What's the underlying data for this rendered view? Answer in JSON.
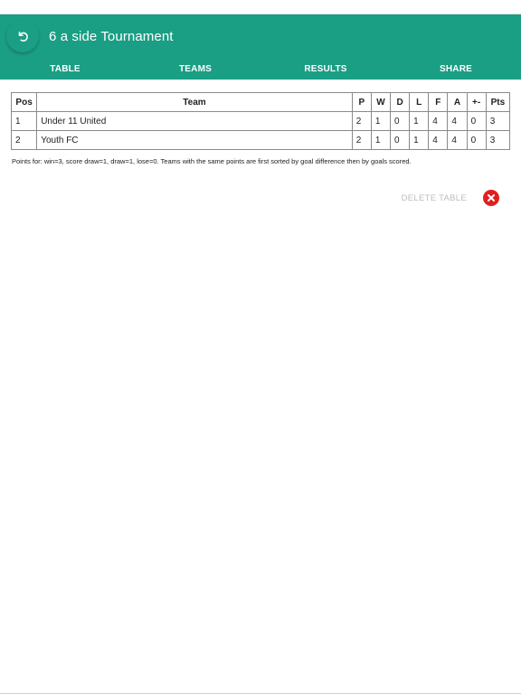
{
  "header": {
    "title": "6 a side Tournament",
    "back_icon": "undo-arrow-icon"
  },
  "tabs": [
    {
      "label": "TABLE"
    },
    {
      "label": "TEAMS"
    },
    {
      "label": "RESULTS"
    },
    {
      "label": "SHARE"
    }
  ],
  "table": {
    "columns": [
      "Pos",
      "Team",
      "P",
      "W",
      "D",
      "L",
      "F",
      "A",
      "+-",
      "Pts"
    ],
    "rows": [
      {
        "pos": "1",
        "team": "Under 11 United",
        "p": "2",
        "w": "1",
        "d": "0",
        "l": "1",
        "f": "4",
        "a": "4",
        "gd": "0",
        "pts": "3"
      },
      {
        "pos": "2",
        "team": "Youth FC",
        "p": "2",
        "w": "1",
        "d": "0",
        "l": "1",
        "f": "4",
        "a": "4",
        "gd": "0",
        "pts": "3"
      }
    ]
  },
  "note": "Points for: win=3, score draw=1, draw=1, lose=0. Teams with the same points are first sorted by goal difference then by goals scored.",
  "actions": {
    "delete_label": "DELETE TABLE",
    "delete_icon": "close-circle-icon",
    "delete_color": "#e0201f"
  },
  "colors": {
    "accent": "#1a9e84"
  }
}
